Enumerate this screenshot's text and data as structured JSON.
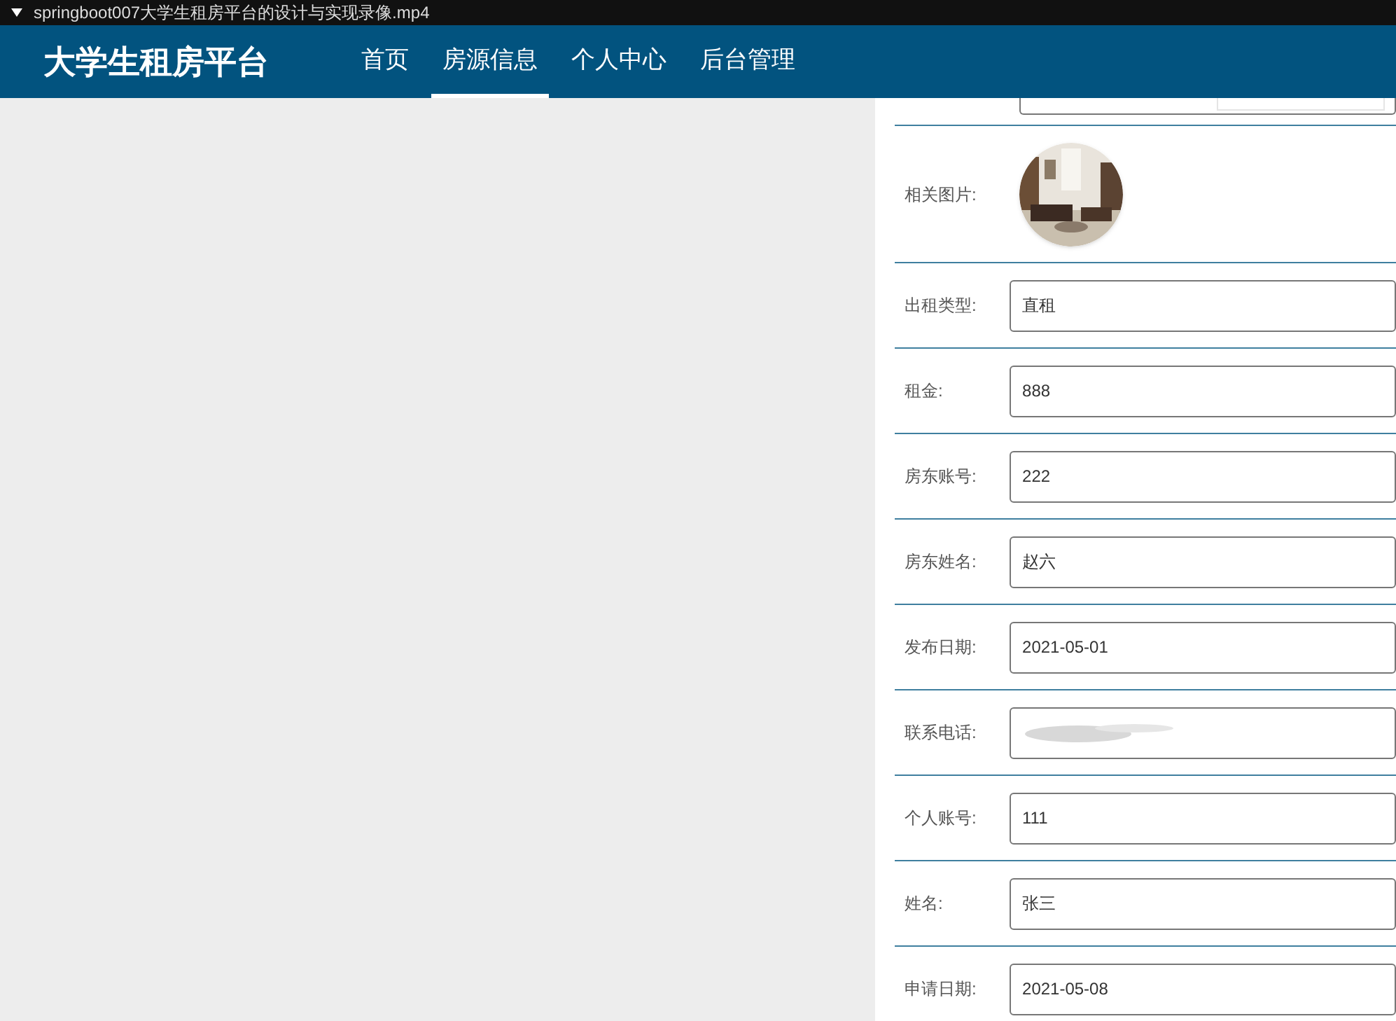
{
  "video_title_bar": {
    "title": "springboot007大学生租房平台的设计与实现录像.mp4"
  },
  "navbar": {
    "brand": "大学生租房平台",
    "items": [
      {
        "label": "首页",
        "selected": false
      },
      {
        "label": "房源信息",
        "selected": true
      },
      {
        "label": "个人中心",
        "selected": false
      },
      {
        "label": "后台管理",
        "selected": false
      }
    ]
  },
  "form": {
    "image_label": "相关图片:",
    "fields": [
      {
        "label": "出租类型:",
        "value": "直租",
        "kind": "text"
      },
      {
        "label": "租金:",
        "value": "888",
        "kind": "text"
      },
      {
        "label": "房东账号:",
        "value": "222",
        "kind": "text"
      },
      {
        "label": "房东姓名:",
        "value": "赵六",
        "kind": "text"
      },
      {
        "label": "发布日期:",
        "value": "2021-05-01",
        "kind": "text"
      },
      {
        "label": "联系电话:",
        "kind": "redacted"
      },
      {
        "label": "个人账号:",
        "value": "111",
        "kind": "text"
      },
      {
        "label": "姓名:",
        "value": "张三",
        "kind": "text"
      },
      {
        "label": "申请日期:",
        "value": "2021-05-08",
        "kind": "text"
      }
    ]
  }
}
